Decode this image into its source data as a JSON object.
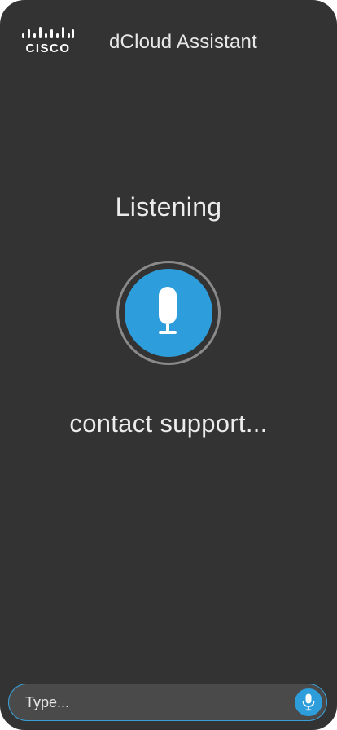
{
  "header": {
    "logo_text": "CISCO",
    "title": "dCloud Assistant"
  },
  "voice": {
    "status": "Listening",
    "transcript": "contact support...",
    "mic_icon": "microphone-icon"
  },
  "input": {
    "placeholder": "Type...",
    "value": "",
    "mic_icon": "microphone-icon"
  },
  "colors": {
    "background": "#333333",
    "accent": "#2d9ddb",
    "ring": "#8a8a8a",
    "input_background": "#4a4a4a",
    "input_border": "#3a9fd9"
  }
}
